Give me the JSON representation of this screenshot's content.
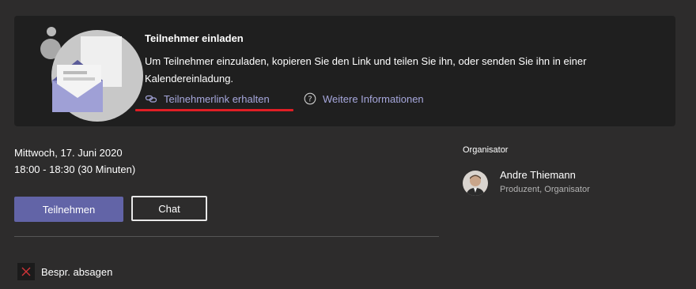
{
  "invite": {
    "title": "Teilnehmer einladen",
    "description": "Um Teilnehmer einzuladen, kopieren Sie den Link und teilen Sie ihn, oder senden Sie ihn in einer Kalendereinladung.",
    "link_label": "Teilnehmerlink erhalten",
    "info_label": "Weitere Informationen",
    "link_icon": "link-icon",
    "info_icon": "info-icon",
    "highlight_color": "#e01e25"
  },
  "meeting": {
    "date": "Mittwoch, 17. Juni 2020",
    "time": "18:00 - 18:30 (30 Minuten)",
    "join_label": "Teilnehmen",
    "chat_label": "Chat",
    "cancel_label": "Bespr. absagen",
    "accent_color": "#6264a7"
  },
  "organizer": {
    "section_label": "Organisator",
    "name": "Andre Thiemann",
    "role": "Produzent, Organisator"
  }
}
